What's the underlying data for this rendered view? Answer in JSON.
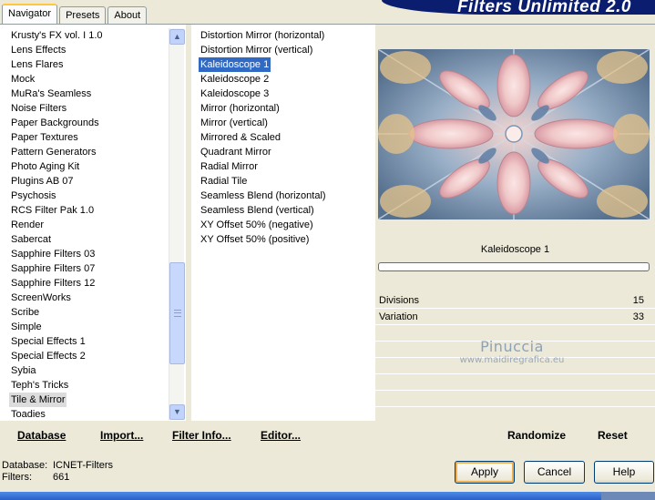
{
  "header": {
    "title": "Filters Unlimited 2.0"
  },
  "tabs": [
    "Navigator",
    "Presets",
    "About"
  ],
  "categories": [
    "Krusty's FX vol. I 1.0",
    "Lens Effects",
    "Lens Flares",
    "Mock",
    "MuRa's Seamless",
    "Noise Filters",
    "Paper Backgrounds",
    "Paper Textures",
    "Pattern Generators",
    "Photo Aging Kit",
    "Plugins AB 07",
    "Psychosis",
    "RCS Filter Pak 1.0",
    "Render",
    "Sabercat",
    "Sapphire Filters 03",
    "Sapphire Filters 07",
    "Sapphire Filters 12",
    "ScreenWorks",
    "Scribe",
    "Simple",
    "Special Effects 1",
    "Special Effects 2",
    "Sybia",
    "Teph's Tricks",
    "Tile & Mirror",
    "Toadies"
  ],
  "selected_category": "Tile & Mirror",
  "filters": [
    "Distortion Mirror (horizontal)",
    "Distortion Mirror (vertical)",
    "Kaleidoscope 1",
    "Kaleidoscope 2",
    "Kaleidoscope 3",
    "Mirror (horizontal)",
    "Mirror (vertical)",
    "Mirrored & Scaled",
    "Quadrant Mirror",
    "Radial Mirror",
    "Radial Tile",
    "Seamless Blend (horizontal)",
    "Seamless Blend (vertical)",
    "XY Offset 50% (negative)",
    "XY Offset 50% (positive)"
  ],
  "selected_filter": "Kaleidoscope 1",
  "scrollbar": {
    "position_fraction": 0.62
  },
  "preview": {
    "filter_name": "Kaleidoscope 1",
    "progress": 0
  },
  "params": [
    {
      "name": "Divisions",
      "value": "15"
    },
    {
      "name": "Variation",
      "value": "33"
    }
  ],
  "watermark": {
    "line1": "Pinuccia",
    "line2": "www.maidiregrafica.eu"
  },
  "bottom_links": {
    "database": "Database",
    "import": "Import...",
    "filter_info": "Filter Info...",
    "editor": "Editor...",
    "randomize": "Randomize",
    "reset": "Reset"
  },
  "status": {
    "database_label": "Database:",
    "database_value": "ICNET-Filters",
    "filters_label": "Filters:",
    "filters_value": "661"
  },
  "buttons": {
    "apply": "Apply",
    "cancel": "Cancel",
    "help": "Help"
  },
  "icons": {
    "scroll_up": "scroll-up-icon",
    "scroll_down": "scroll-down-icon"
  }
}
